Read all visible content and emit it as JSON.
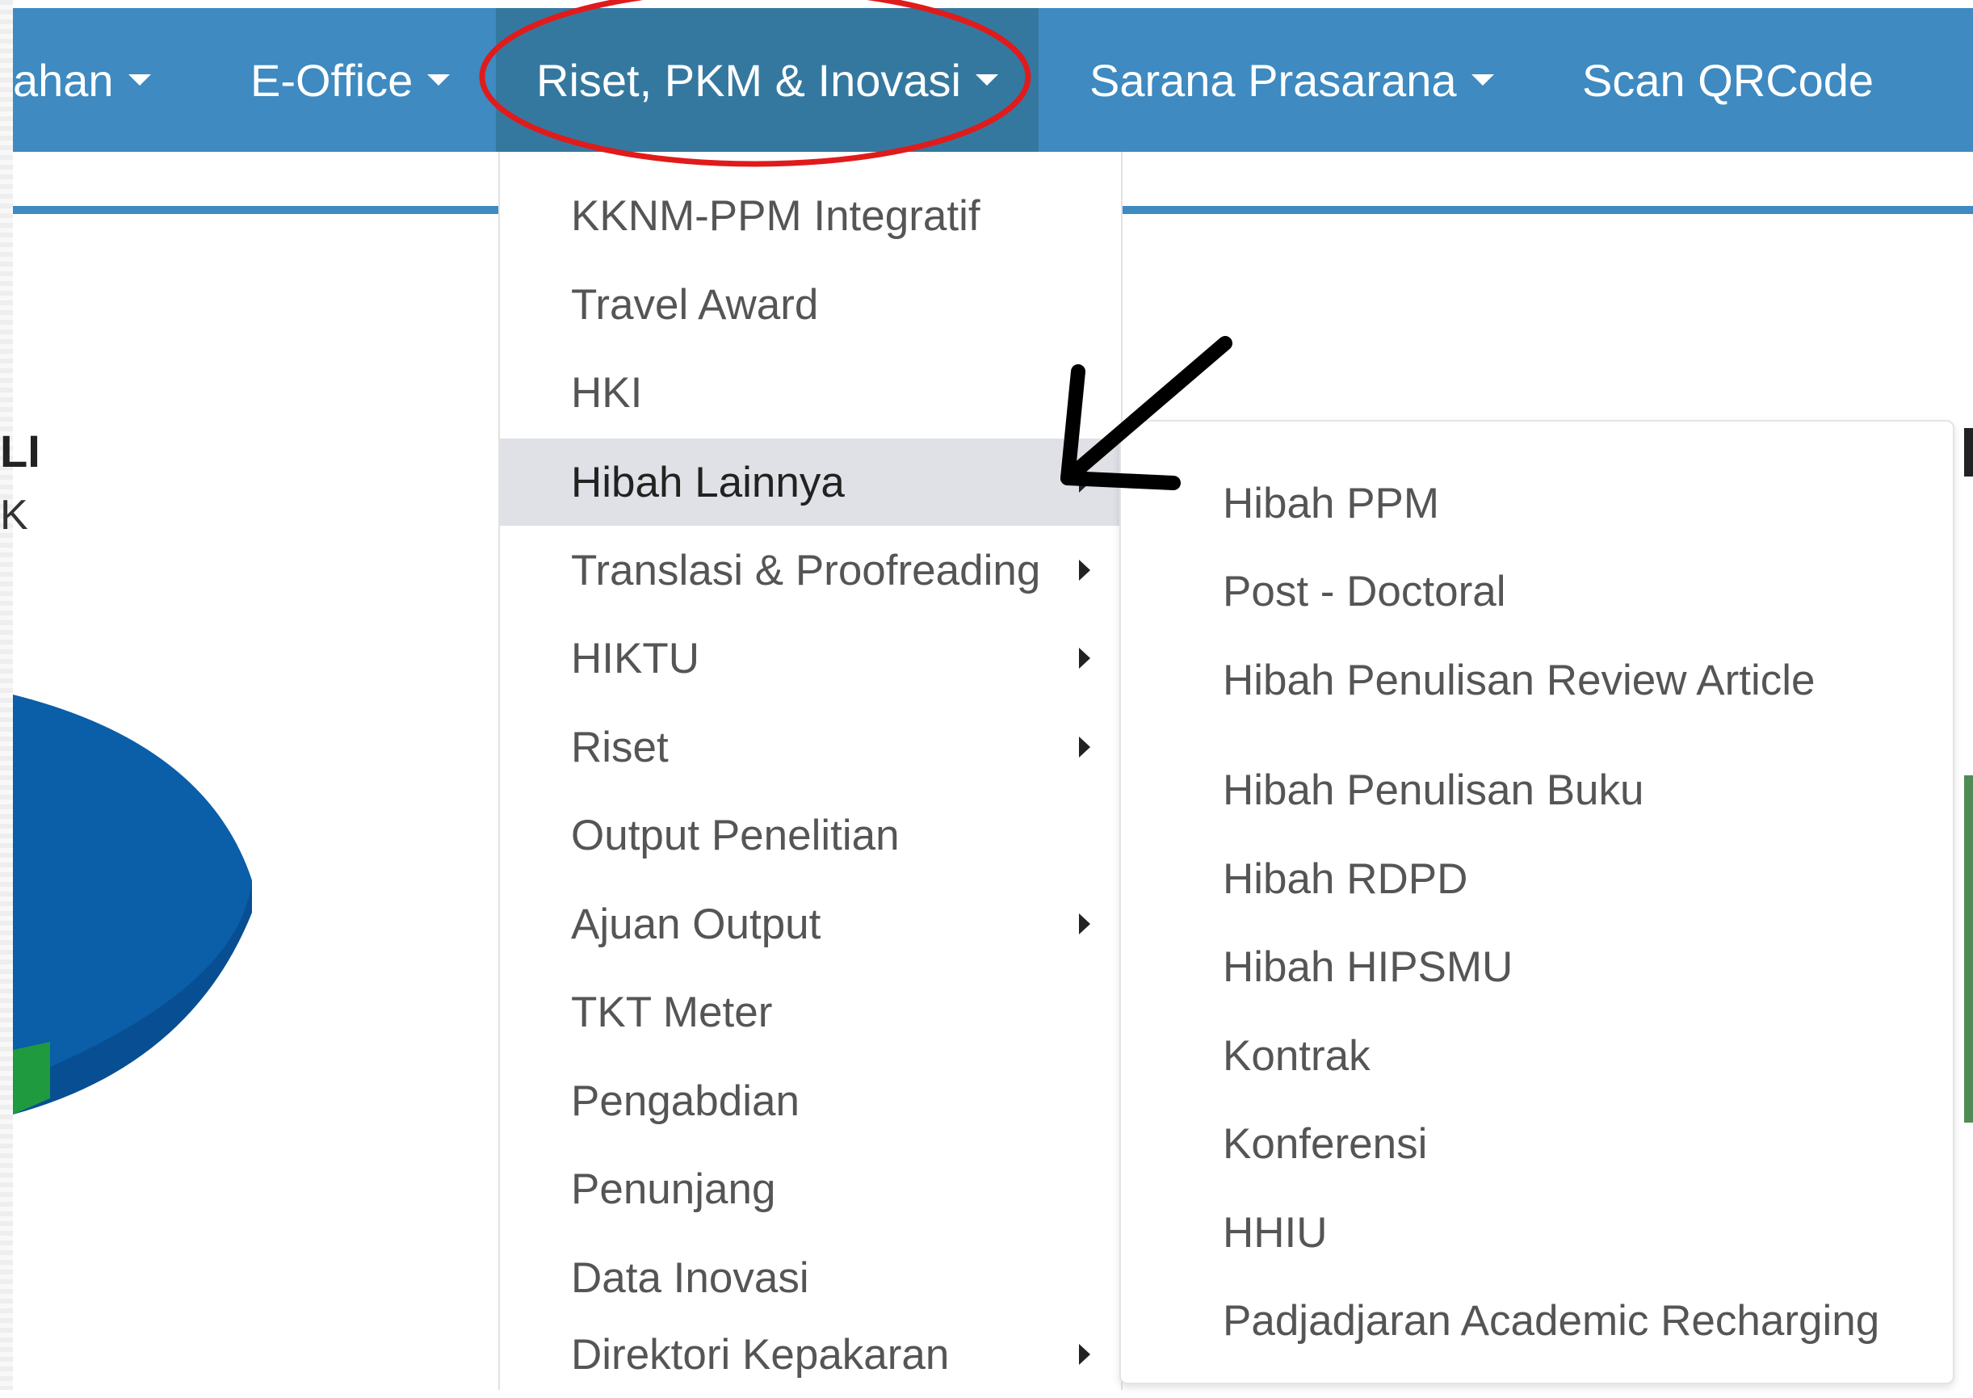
{
  "navbar": {
    "items": [
      {
        "label": "ahan"
      },
      {
        "label": "E-Office"
      },
      {
        "label": "Riset, PKM & Inovasi"
      },
      {
        "label": "Sarana Prasarana"
      },
      {
        "label": "Scan QRCode"
      }
    ]
  },
  "background": {
    "title_fragment": "LI",
    "subtitle_fragment": "K"
  },
  "dropdown": {
    "items": [
      {
        "label": "KKNM-PPM Integratif"
      },
      {
        "label": "Travel Award"
      },
      {
        "label": "HKI"
      },
      {
        "label": "Hibah Lainnya"
      },
      {
        "label": "Translasi & Proofreading"
      },
      {
        "label": "HIKTU"
      },
      {
        "label": "Riset"
      },
      {
        "label": "Output Penelitian"
      },
      {
        "label": "Ajuan Output"
      },
      {
        "label": "TKT Meter"
      },
      {
        "label": "Pengabdian"
      },
      {
        "label": "Penunjang"
      },
      {
        "label": "Data Inovasi"
      },
      {
        "label": "Direktori Kepakaran"
      }
    ]
  },
  "submenu": {
    "items": [
      {
        "label": "Hibah PPM"
      },
      {
        "label": "Post - Doctoral"
      },
      {
        "label": "Hibah Penulisan Review Article"
      },
      {
        "label": "Hibah Penulisan Buku"
      },
      {
        "label": "Hibah RDPD"
      },
      {
        "label": "Hibah HIPSMU"
      },
      {
        "label": "Kontrak"
      },
      {
        "label": "Konferensi"
      },
      {
        "label": "HHIU"
      },
      {
        "label": "Padjadjaran Academic Recharging"
      }
    ]
  },
  "colors": {
    "navbar": "#3e8ac1",
    "navbar_active": "#35789f",
    "highlight_circle": "#e01b1b",
    "pie_blue": "#0b5ea8",
    "pie_green": "#1f9a3e"
  },
  "icons": [
    "caret-down-icon",
    "caret-right-icon",
    "annotation-arrow-icon",
    "annotation-circle-icon"
  ]
}
